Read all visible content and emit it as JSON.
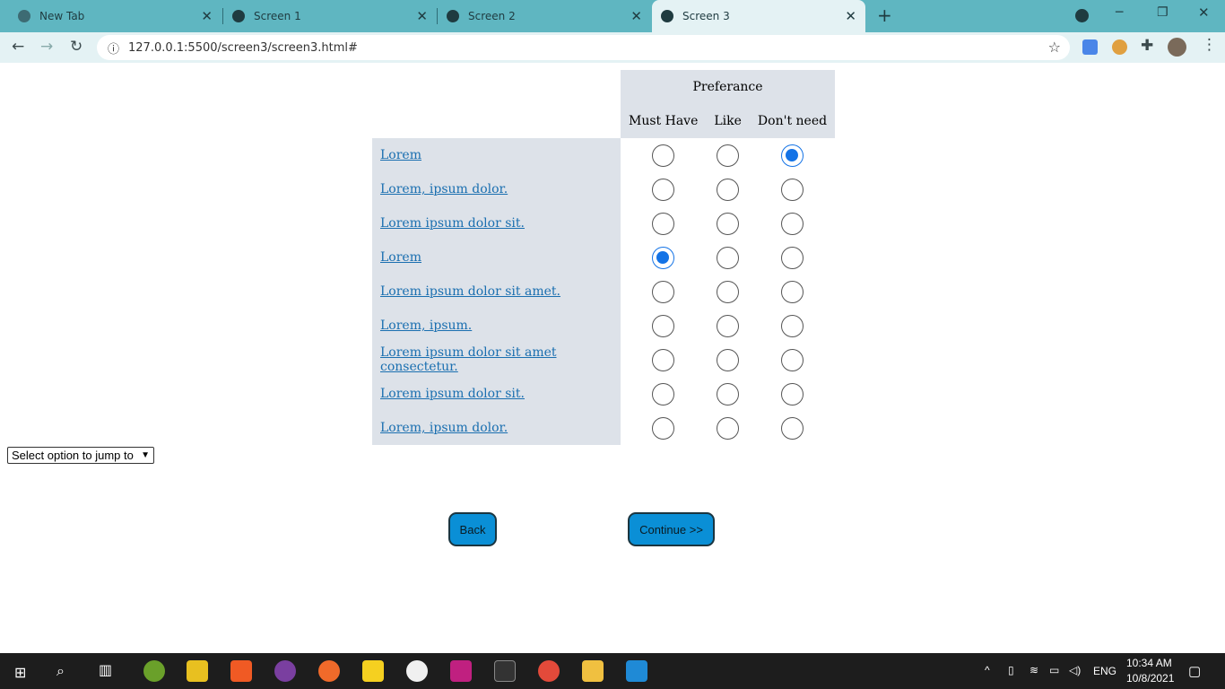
{
  "browser": {
    "tabs": [
      {
        "title": "New Tab",
        "active": false
      },
      {
        "title": "Screen 1",
        "active": false
      },
      {
        "title": "Screen 2",
        "active": false
      },
      {
        "title": "Screen 3",
        "active": true
      }
    ],
    "url": "127.0.0.1:5500/screen3/screen3.html#",
    "new_tab": "+"
  },
  "table": {
    "group_header": "Preferance",
    "columns": [
      "Must Have",
      "Like",
      "Don't need"
    ],
    "rows": [
      {
        "label": "Lorem",
        "selected": 2
      },
      {
        "label": "Lorem, ipsum dolor.",
        "selected": -1
      },
      {
        "label": "Lorem ipsum dolor sit.",
        "selected": -1
      },
      {
        "label": "Lorem",
        "selected": 0
      },
      {
        "label": "Lorem ipsum dolor sit amet.",
        "selected": -1
      },
      {
        "label": "Lorem, ipsum.",
        "selected": -1
      },
      {
        "label": "Lorem ipsum dolor sit amet consectetur.",
        "selected": -1
      },
      {
        "label": "Lorem ipsum dolor sit.",
        "selected": -1
      },
      {
        "label": "Lorem, ipsum dolor.",
        "selected": -1
      }
    ]
  },
  "jump_select": {
    "value": "Select option to jump to"
  },
  "buttons": {
    "back": "Back",
    "continue": "Continue >>"
  },
  "taskbar": {
    "lang": "ENG",
    "time": "10:34 AM",
    "date": "10/8/2021"
  },
  "colors": {
    "accent": "#0a8fd6",
    "radio": "#1473e6",
    "tabbar": "#5fb6c1"
  }
}
